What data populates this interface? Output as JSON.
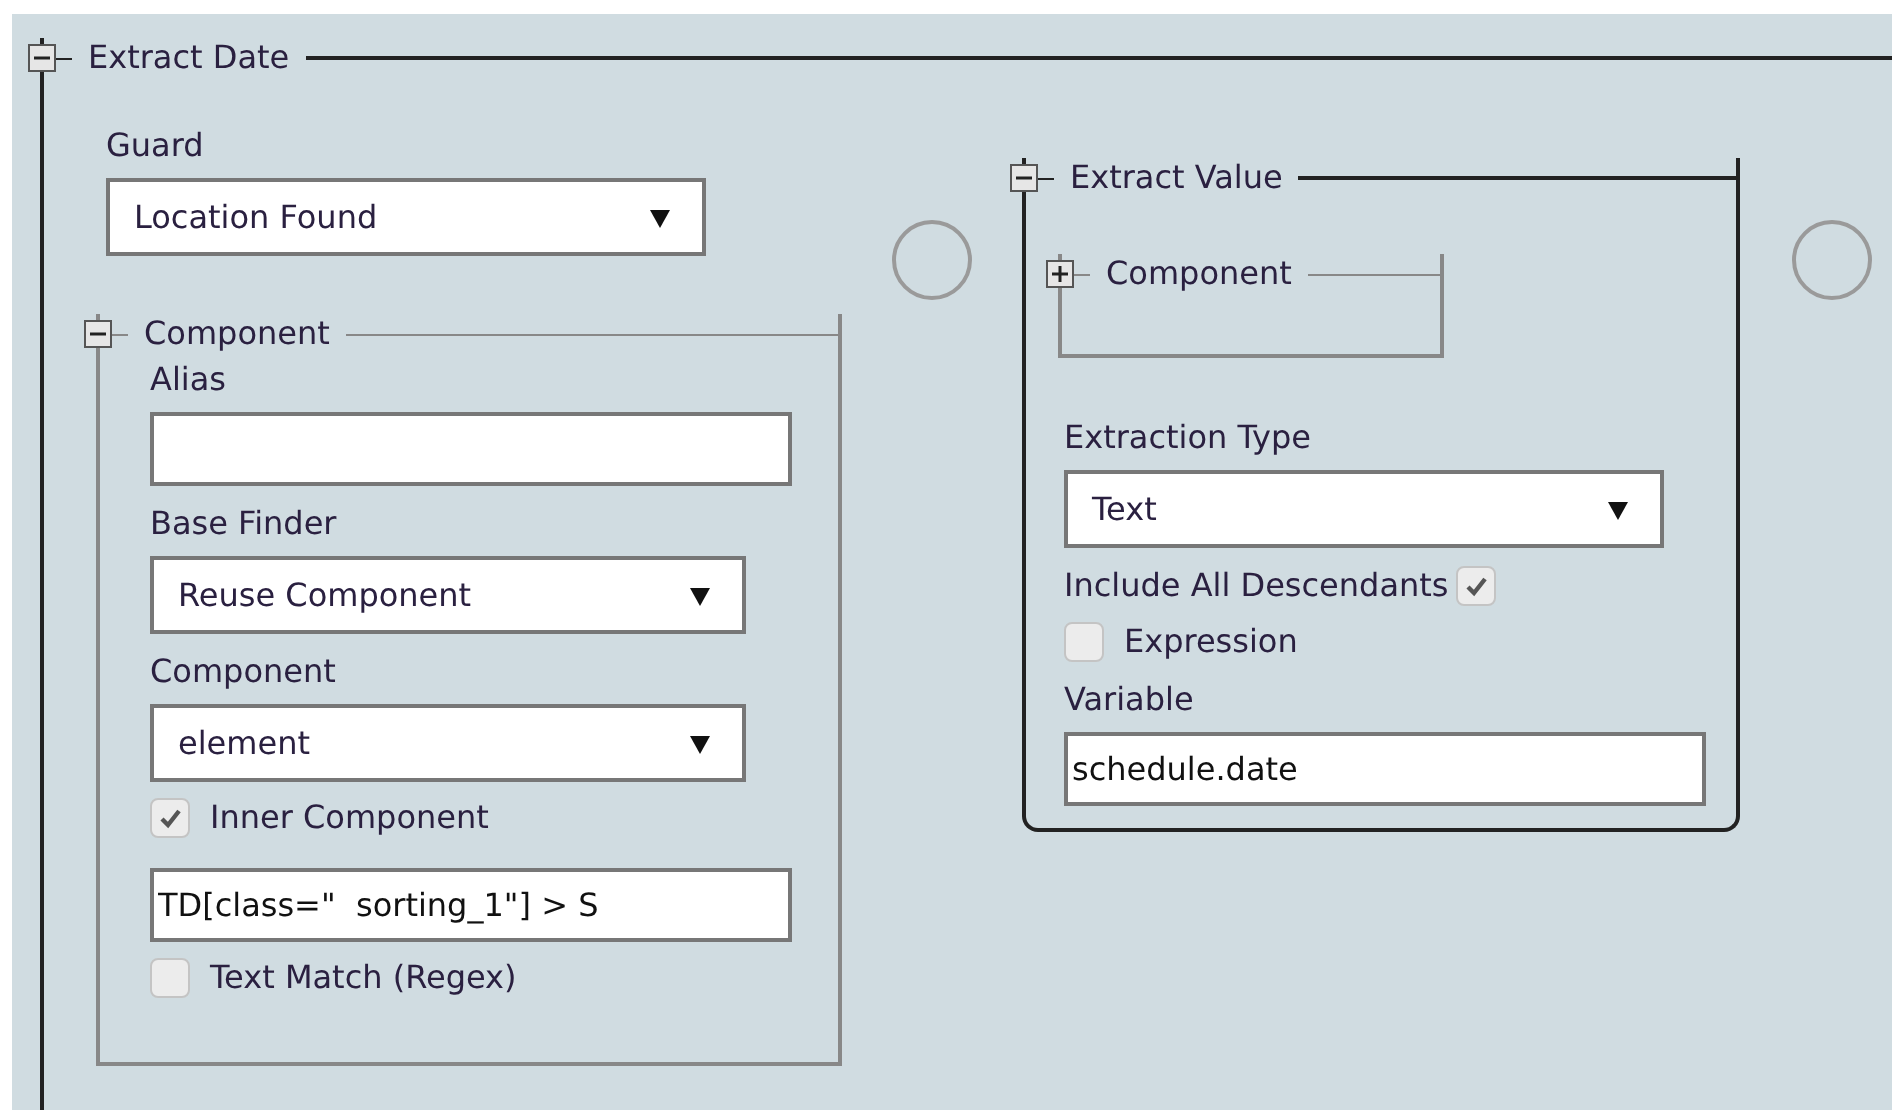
{
  "extract_date": {
    "title": "Extract Date",
    "expanded": true,
    "guard": {
      "label": "Guard",
      "value": "Location Found"
    },
    "component": {
      "title": "Component",
      "expanded": true,
      "fields": [
        {
          "kind": "input",
          "label": "Alias"
        },
        {
          "kind": "select",
          "label": "Base Finder",
          "value": "Reuse Component"
        },
        {
          "kind": "select",
          "label": "Component",
          "value": "element"
        },
        {
          "kind": "checkbox",
          "label": "Inner Component",
          "checked": true
        },
        {
          "kind": "input",
          "value": "TD[class=\"  sorting_1\"] > S"
        },
        {
          "kind": "checkbox",
          "label": "Text Match (Regex)",
          "checked": false
        }
      ]
    },
    "extract_value": {
      "title": "Extract Value",
      "expanded": true,
      "component": {
        "title": "Component",
        "expanded": false
      },
      "fields": [
        {
          "kind": "select",
          "label": "Extraction Type",
          "value": "Text"
        },
        {
          "kind": "checkbox_after",
          "label": "Include All Descendants",
          "checked": true
        },
        {
          "kind": "checkbox",
          "label": "Expression",
          "checked": false
        },
        {
          "kind": "input",
          "label": "Variable",
          "value": "schedule.date"
        }
      ]
    }
  }
}
